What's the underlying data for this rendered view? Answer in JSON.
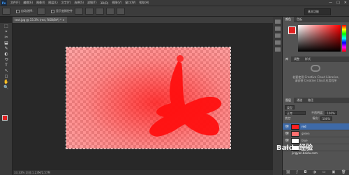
{
  "menubar": {
    "logo": "Ps",
    "items": [
      "文件(F)",
      "编辑(E)",
      "图像(I)",
      "图层(L)",
      "文字(Y)",
      "选择(S)",
      "滤镜(T)",
      "3D(D)",
      "视图(V)",
      "窗口(W)",
      "帮助(H)"
    ],
    "window_controls": [
      "—",
      "□",
      "✕"
    ]
  },
  "options_bar": {
    "checkbox1_label": "自动选择：",
    "checkbox2_label": "显示变换控件",
    "workspace": "基本功能"
  },
  "document": {
    "tab_label": "test.jpg @ 33.3% (red, RGB/8#) * ×",
    "status": "33.33%  文档:1.23M/2.57M"
  },
  "tools": [
    "⬚",
    "⌖",
    "✂",
    "⬓",
    "✎",
    "◐",
    "⟲",
    "T",
    "↖",
    "◻",
    "✋",
    "🔍"
  ],
  "color_panel": {
    "tabs": [
      "颜色",
      "色板"
    ],
    "foreground": "#e02020",
    "background": "#ffffff"
  },
  "libraries_panel": {
    "tabs": [
      "库",
      "调整",
      "样式"
    ],
    "line1": "若要使用 Creative Cloud Libraries,",
    "line2": "请安装 Creative Cloud 应用程序"
  },
  "layers_panel": {
    "tabs": [
      "图层",
      "通道",
      "路径"
    ],
    "kind_filter": "类型",
    "blend_mode": "正常",
    "opacity_label": "不透明度:",
    "opacity_value": "100%",
    "lock_label": "锁定:",
    "fill_label": "填充:",
    "fill_value": "100%",
    "layers": [
      {
        "name": "red",
        "color": "#ff2020",
        "selected": true
      },
      {
        "name": "green",
        "color": "#ff7070",
        "selected": false
      },
      {
        "name": "blue",
        "color": "#ffffff",
        "selected": false
      },
      {
        "name": "背景",
        "color": "#ffffff",
        "selected": false
      }
    ],
    "footer_icons": [
      "link-icon",
      "fx-icon",
      "mask-icon",
      "adjust-icon",
      "folder-icon",
      "new-layer-icon",
      "trash-icon"
    ]
  },
  "watermark": {
    "text": "Baidu经验",
    "sub": "jingyan.baidu.com"
  }
}
